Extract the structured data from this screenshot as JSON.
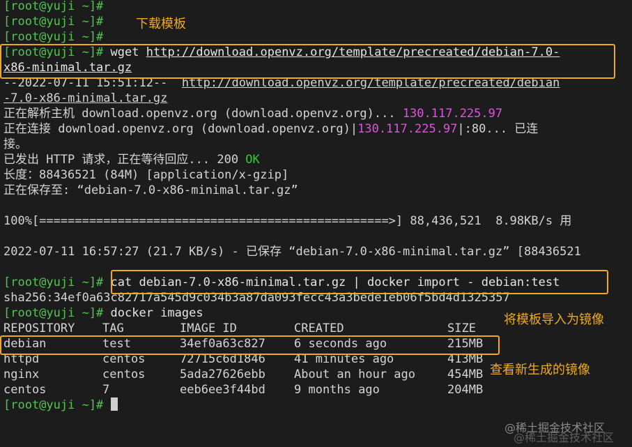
{
  "prompt": "[root@yuji ~]#",
  "commands": {
    "wget": " wget",
    "wget_url_1": "http://download.openvz.org/template/precreated/debian-7.0-",
    "wget_url_2": "x86-minimal.tar.gz",
    "cat": " cat debian-7.0-x86-minimal.tar.gz | docker import - debian:test",
    "images": " docker images"
  },
  "output": {
    "ts_prefix": "--2022-07-11 15:51:12--  ",
    "ts_url": "http://download.openvz.org/template/precreated/debian",
    "ts_url_2": "-7.0-x86-minimal.tar.gz",
    "resolving": "正在解析主机 download.openvz.org (download.openvz.org)... ",
    "resolving_ip": "130.117.225.97",
    "connecting_1": "正在连接 download.openvz.org (download.openvz.org)|",
    "connecting_ip": "130.117.225.97",
    "connecting_2": "|:80... 已连",
    "connecting_3": "接。",
    "http_sent": "已发出 HTTP 请求，正在等待回应... 200 ",
    "http_ok": "OK",
    "length": "长度：88436521 (84M) [application/x-gzip]",
    "saving": "正在保存至: “debian-7.0-x86-minimal.tar.gz”",
    "progress": "100%[=================================================>] 88,436,521  8.98KB/s 用",
    "saved": "2022-07-11 16:57:27 (21.7 KB/s) - 已保存 “debian-7.0-x86-minimal.tar.gz” [88436521",
    "sha": "sha256:34ef0a63c82717a545d9c034b3a87da093fecc43a3bede1eb06f5bd4d1325357"
  },
  "images_table": {
    "headers": [
      "REPOSITORY",
      "TAG",
      "IMAGE ID",
      "CREATED",
      "SIZE"
    ],
    "rows": [
      [
        "debian",
        "test",
        "34ef0a63c827",
        "6 seconds ago",
        "215MB"
      ],
      [
        "httpd",
        "centos",
        "72715c6d1846",
        "41 minutes ago",
        "413MB"
      ],
      [
        "nginx",
        "centos",
        "5ada27626ebb",
        "About an hour ago",
        "454MB"
      ],
      [
        "centos",
        "7",
        "eeb6ee3f44bd",
        "9 months ago",
        "204MB"
      ]
    ]
  },
  "annotations": {
    "download_template": "下载模板",
    "import_as_image": "将模板导入为镜像",
    "view_new_image": "查看新生成的镜像"
  },
  "watermark": "@稀土掘金技术社区",
  "colors": {
    "background": "#1c1c1c",
    "prompt_green": "#4ec94e",
    "ip_magenta": "#e052e0",
    "annotation_orange": "#f0a91f"
  }
}
